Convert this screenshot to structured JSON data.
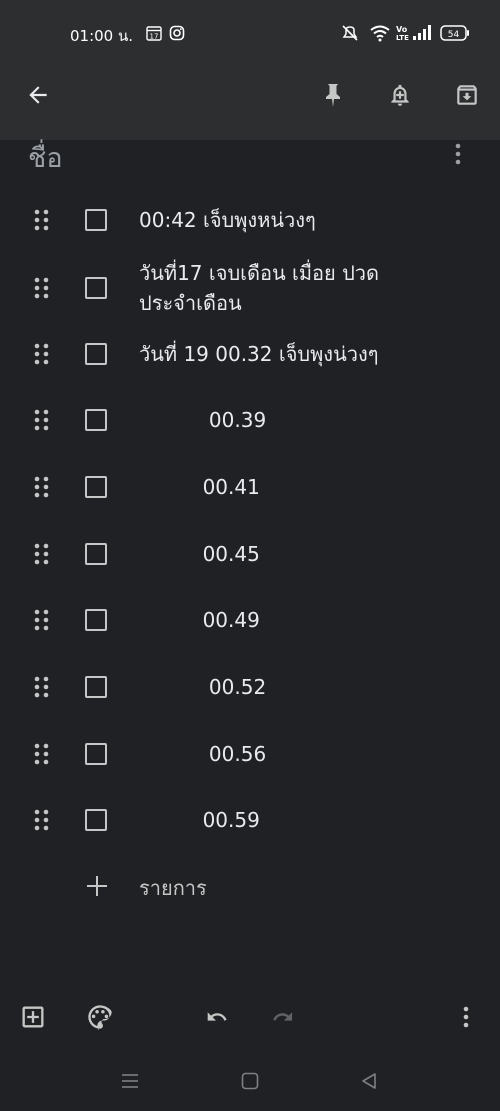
{
  "status_bar": {
    "time": "01:00 น.",
    "calendar_day": "17",
    "battery": "54"
  },
  "note": {
    "title_placeholder": "ชื่อ",
    "items": [
      {
        "text": "00:42 เจ็บพุงหน่วงๆ",
        "checked": false
      },
      {
        "text": "วันที่17 เจบเดือน เมื่อย ปวด\nประจำเดือน",
        "checked": false
      },
      {
        "text": "วันที่ 19 00.32 เจ็บพุงน่วงๆ",
        "checked": false
      },
      {
        "text": "           00.39",
        "checked": false
      },
      {
        "text": "          00.41",
        "checked": false
      },
      {
        "text": "          00.45",
        "checked": false
      },
      {
        "text": "          00.49",
        "checked": false
      },
      {
        "text": "           00.52",
        "checked": false
      },
      {
        "text": "           00.56",
        "checked": false
      },
      {
        "text": "          00.59",
        "checked": false
      }
    ],
    "add_item_label": "รายการ"
  },
  "colors": {
    "background": "#202124",
    "topbar": "#2d2e30",
    "text": "#e8eaed",
    "icon": "#c4c7c5",
    "disabled_icon": "#5f6368"
  },
  "icons": {
    "back": "arrow-left-icon",
    "pin": "pin-icon",
    "reminder": "bell-plus-icon",
    "archive": "archive-icon",
    "more": "more-vert-icon",
    "drag": "drag-handle-icon",
    "add_box": "add-box-icon",
    "palette": "palette-icon",
    "undo": "undo-icon",
    "redo": "redo-icon"
  }
}
